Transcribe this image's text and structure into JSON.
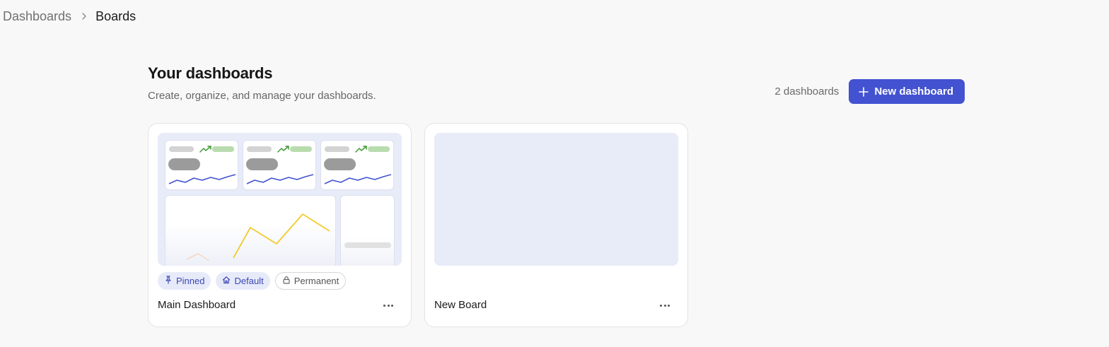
{
  "breadcrumb": {
    "root": "Dashboards",
    "current": "Boards",
    "separator_icon": "chevron-right-icon"
  },
  "header": {
    "title": "Your dashboards",
    "subtitle": "Create, organize, and manage your dashboards."
  },
  "toolbar": {
    "count_label": "2 dashboards",
    "new_button_label": "New dashboard",
    "new_button_icon": "plus-icon"
  },
  "colors": {
    "accent": "#4352d0",
    "tag_blue_bg": "#e7eaf9",
    "tag_blue_text": "#3c48b5",
    "preview_bg": "#e8ebf8",
    "sparkline": "#4352d0",
    "trend_green": "#3f9a33",
    "chart_line": "#f2cb2e"
  },
  "dashboards": [
    {
      "title": "Main Dashboard",
      "has_preview": true,
      "tags": [
        {
          "label": "Pinned",
          "icon": "pin-icon",
          "style": "blue"
        },
        {
          "label": "Default",
          "icon": "home-icon",
          "style": "blue"
        },
        {
          "label": "Permanent",
          "icon": "lock-icon",
          "style": "outline"
        }
      ],
      "menu_icon": "more-horizontal-icon"
    },
    {
      "title": "New Board",
      "has_preview": false,
      "tags": [],
      "menu_icon": "more-horizontal-icon"
    }
  ]
}
